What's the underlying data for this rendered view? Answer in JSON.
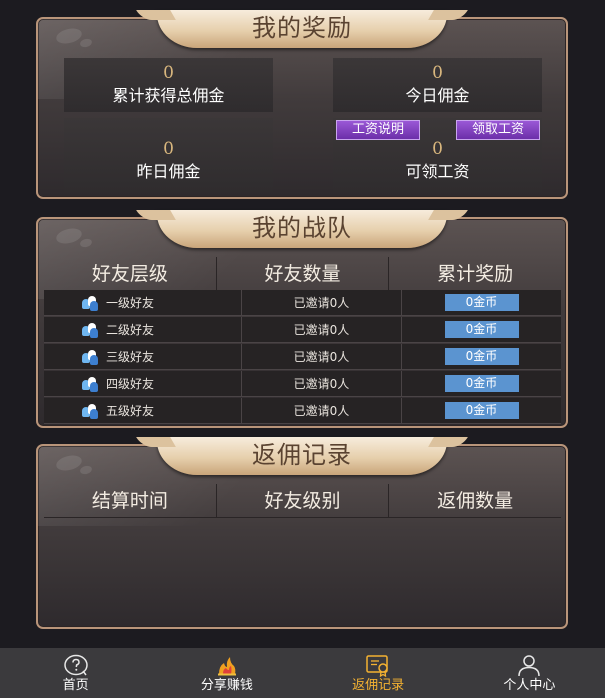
{
  "rewards": {
    "title": "我的奖励",
    "total_commission": {
      "value": "0",
      "label": "累计获得总佣金"
    },
    "today_commission": {
      "value": "0",
      "label": "今日佣金"
    },
    "yesterday_commission": {
      "value": "0",
      "label": "昨日佣金"
    },
    "claimable_wage": {
      "value": "0",
      "label": "可领工资"
    },
    "wage_info_button": "工资说明",
    "claim_wage_button": "领取工资"
  },
  "team": {
    "title": "我的战队",
    "headers": [
      "好友层级",
      "好友数量",
      "累计奖励"
    ],
    "rows": [
      {
        "level": "一级好友",
        "invited": "已邀请0人",
        "reward": "0金币"
      },
      {
        "level": "二级好友",
        "invited": "已邀请0人",
        "reward": "0金币"
      },
      {
        "level": "三级好友",
        "invited": "已邀请0人",
        "reward": "0金币"
      },
      {
        "level": "四级好友",
        "invited": "已邀请0人",
        "reward": "0金币"
      },
      {
        "level": "五级好友",
        "invited": "已邀请0人",
        "reward": "0金币"
      }
    ]
  },
  "records": {
    "title": "返佣记录",
    "headers": [
      "结算时间",
      "好友级别",
      "返佣数量"
    ]
  },
  "nav": {
    "items": [
      {
        "label": "首页",
        "icon": "help-circle-icon"
      },
      {
        "label": "分享赚钱",
        "icon": "flame-icon"
      },
      {
        "label": "返佣记录",
        "icon": "certificate-icon",
        "active": true
      },
      {
        "label": "个人中心",
        "icon": "user-icon"
      }
    ]
  },
  "colors": {
    "accent": "#f4b232",
    "purple_button": "#7b3cbd",
    "coin_badge": "#5b94d0",
    "panel_border": "#b9957a"
  }
}
